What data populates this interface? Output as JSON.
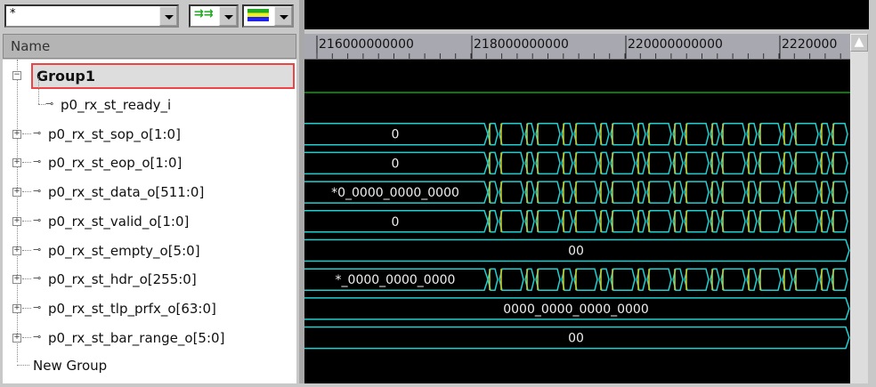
{
  "toolbar": {
    "filter_value": "*"
  },
  "name_header": "Name",
  "group": "Group1",
  "signals": [
    {
      "name": "p0_rx_st_ready_i",
      "value": "",
      "bus": false,
      "toggling": false
    },
    {
      "name": "p0_rx_st_sop_o[1:0]",
      "value": "0",
      "bus": true,
      "toggling": true
    },
    {
      "name": "p0_rx_st_eop_o[1:0]",
      "value": "0",
      "bus": true,
      "toggling": true
    },
    {
      "name": "p0_rx_st_data_o[511:0]",
      "value": "*0_0000_0000_0000",
      "bus": true,
      "toggling": true
    },
    {
      "name": "p0_rx_st_valid_o[1:0]",
      "value": "0",
      "bus": true,
      "toggling": true
    },
    {
      "name": "p0_rx_st_empty_o[5:0]",
      "value": "00",
      "bus": true,
      "toggling": false
    },
    {
      "name": "p0_rx_st_hdr_o[255:0]",
      "value": "*_0000_0000_0000",
      "bus": true,
      "toggling": true
    },
    {
      "name": "p0_rx_st_tlp_prfx_o[63:0]",
      "value": "0000_0000_0000_0000",
      "bus": true,
      "toggling": false
    },
    {
      "name": "p0_rx_st_bar_range_o[5:0]",
      "value": "00",
      "bus": true,
      "toggling": false
    }
  ],
  "new_group": "New Group",
  "ruler": [
    "216000000000",
    "218000000000",
    "220000000000",
    "2220000"
  ],
  "colors": {
    "bus": "#20d0d0",
    "edge": "#d0d020",
    "single": "#10a010"
  }
}
